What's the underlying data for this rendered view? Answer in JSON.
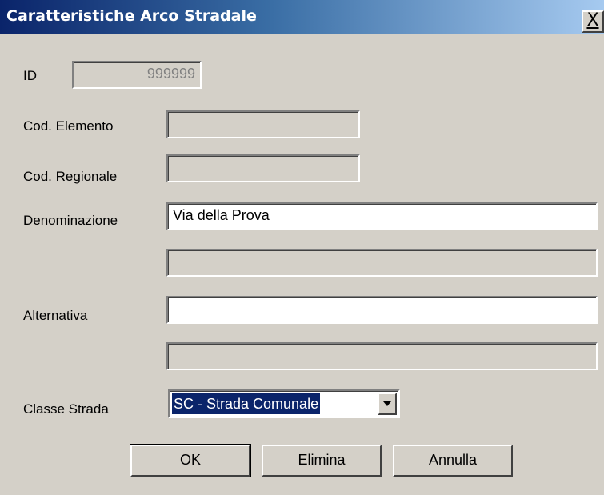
{
  "window": {
    "title": "Caratteristiche Arco Stradale",
    "close_label": "X"
  },
  "form": {
    "id_label": "ID",
    "id_value": "999999",
    "cod_elemento_label": "Cod. Elemento",
    "cod_elemento_value": "",
    "cod_regionale_label": "Cod. Regionale",
    "cod_regionale_value": "",
    "denominazione_label": "Denominazione",
    "denominazione_value": "Via della Prova",
    "denominazione_extra_value": "",
    "alternativa_label": "Alternativa",
    "alternativa_value": "",
    "alternativa_extra_value": "",
    "classe_strada_label": "Classe Strada",
    "classe_strada_value": "SC - Strada Comunale"
  },
  "buttons": {
    "ok": "OK",
    "elimina": "Elimina",
    "annulla": "Annulla"
  }
}
